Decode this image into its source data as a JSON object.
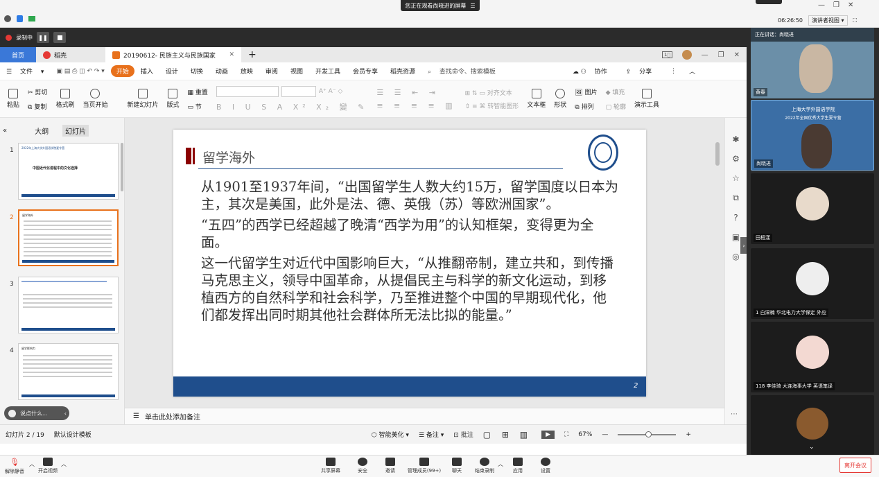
{
  "topbar": {
    "banner": "您正在观看尚晓进的屏幕",
    "time": "06:26:50",
    "view_mode": "演讲者视图"
  },
  "recording": {
    "label": "录制中"
  },
  "tabs": {
    "home": "首页",
    "docer": "稻壳",
    "doc": "20190612- 民族主义与民族国家",
    "plus": "+"
  },
  "menu": {
    "file": "文件",
    "start": "开始",
    "items": [
      "插入",
      "设计",
      "切换",
      "动画",
      "放映",
      "审阅",
      "视图",
      "开发工具",
      "会员专享",
      "稻壳资源"
    ],
    "search": "查找命令、搜索模板",
    "cowork": "协作",
    "share": "分享"
  },
  "ribbon": {
    "paste": "粘贴",
    "cut": "剪切",
    "copy": "复制",
    "format": "格式刷",
    "from_current": "当页开始",
    "new_slide": "新建幻灯片",
    "layout": "版式",
    "section": "节",
    "reset": "重置",
    "align_text": "对齐文本",
    "smart": "转智能图形",
    "textbox": "文本框",
    "shape": "形状",
    "picture": "图片",
    "arrange": "排列",
    "fill": "填充",
    "outline": "轮廓",
    "tools": "演示工具"
  },
  "leftpane": {
    "outline_tab": "大纲",
    "slides_tab": "幻灯片",
    "nums": [
      "1",
      "2",
      "3",
      "4"
    ],
    "t1_title": "2022年上海大学外国语学院夏令营",
    "t1_sub": "中国近代化进程中的文化选择",
    "t2_title": "留学海外",
    "t3_title": "",
    "t4_title": "留学影响力",
    "comment_hint": "说点什么..."
  },
  "slide": {
    "title": "留学海外",
    "number": "2",
    "para1": "从1901至1937年间，“出国留学生人数大约15万，留学国度以日本为主，其次是美国，此外是法、德、英俄（苏）等欧洲国家”。",
    "para2": "“五四”的西学已经超越了晚清“西学为用”的认知框架，变得更为全面。",
    "para3": "这一代留学生对近代中国影响巨大，“从推翻帝制，建立共和，到传播马克思主义，领导中国革命，从提倡民主与科学的新文化运动，到移植西方的自然科学和社会科学，乃至推进整个中国的早期现代化，他们都发挥出同时期其他社会群体所无法比拟的能量。”"
  },
  "notes": {
    "placeholder": "单击此处添加备注"
  },
  "status": {
    "slide_count": "幻灯片 2 / 19",
    "template": "默认设计模板",
    "beautify": "智能美化",
    "notes": "备注",
    "comment": "批注",
    "zoom": "67%"
  },
  "videos": [
    {
      "name": "正在讲话：尚晓进",
      "label": "尚晓进"
    },
    {
      "name": "黄春",
      "label": "黄春"
    },
    {
      "name": "尚晓进",
      "label": "尚晓进",
      "banner1": "上海大学外国语学院",
      "banner2": "2022年全国优秀大学生夏令营"
    },
    {
      "name": "田梧漾",
      "label": "田梧漾"
    },
    {
      "name": "1 白深楠 华北电力大学保定 外应",
      "label": "1 白深楠 华北电力大学保定 外应"
    },
    {
      "name": "118 李佳琦 大连海事大学 英语笔译",
      "label": "118 李佳琦 大连海事大学 英语笔译"
    }
  ],
  "bottombar": {
    "mute": "解除静音",
    "video": "开启视频",
    "share": "共享屏幕",
    "security": "安全",
    "invite": "邀请",
    "members": "管理成员(99+)",
    "chat": "聊天",
    "record": "结束录制",
    "apps": "应用",
    "settings": "设置",
    "leave": "离开会议"
  },
  "colors": {
    "accent": "#1f4e8c",
    "wps_orange": "#e8711c",
    "leave_red": "#e53935"
  }
}
